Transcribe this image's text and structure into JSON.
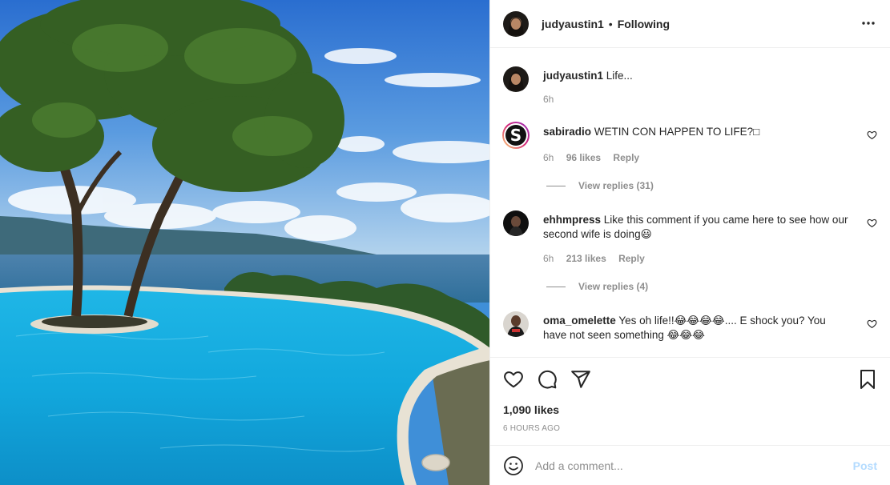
{
  "header": {
    "username": "judyaustin1",
    "separator": "•",
    "follow_status": "Following"
  },
  "caption": {
    "username": "judyaustin1",
    "text": "Life...",
    "time": "6h"
  },
  "comments": [
    {
      "username": "sabiradio",
      "text": "WETIN CON HAPPEN TO LIFE?□",
      "time": "6h",
      "likes": "96 likes",
      "reply": "Reply",
      "view_replies": "View replies (31)"
    },
    {
      "username": "ehhmpress",
      "text": "Like this comment if you came here to see how our second wife is doing😃",
      "time": "6h",
      "likes": "213 likes",
      "reply": "Reply",
      "view_replies": "View replies (4)"
    },
    {
      "username": "oma_omelette",
      "text": "Yes oh life!!😂😂😂😂.... E shock you? You have not seen something 😂😂😂"
    }
  ],
  "post": {
    "likes": "1,090 likes",
    "timestamp": "6 HOURS AGO"
  },
  "add_comment": {
    "placeholder": "Add a comment...",
    "post_label": "Post"
  },
  "sabiradio_avatar_letter": "S",
  "icons": {
    "more": "more-options-icon",
    "like": "heart-icon",
    "comment": "comment-icon",
    "share": "share-icon",
    "save": "bookmark-icon",
    "emoji": "emoji-icon"
  },
  "colors": {
    "text": "#262626",
    "muted": "#8e8e8e",
    "border": "#efefef",
    "post_disabled": "#b3dbff"
  }
}
